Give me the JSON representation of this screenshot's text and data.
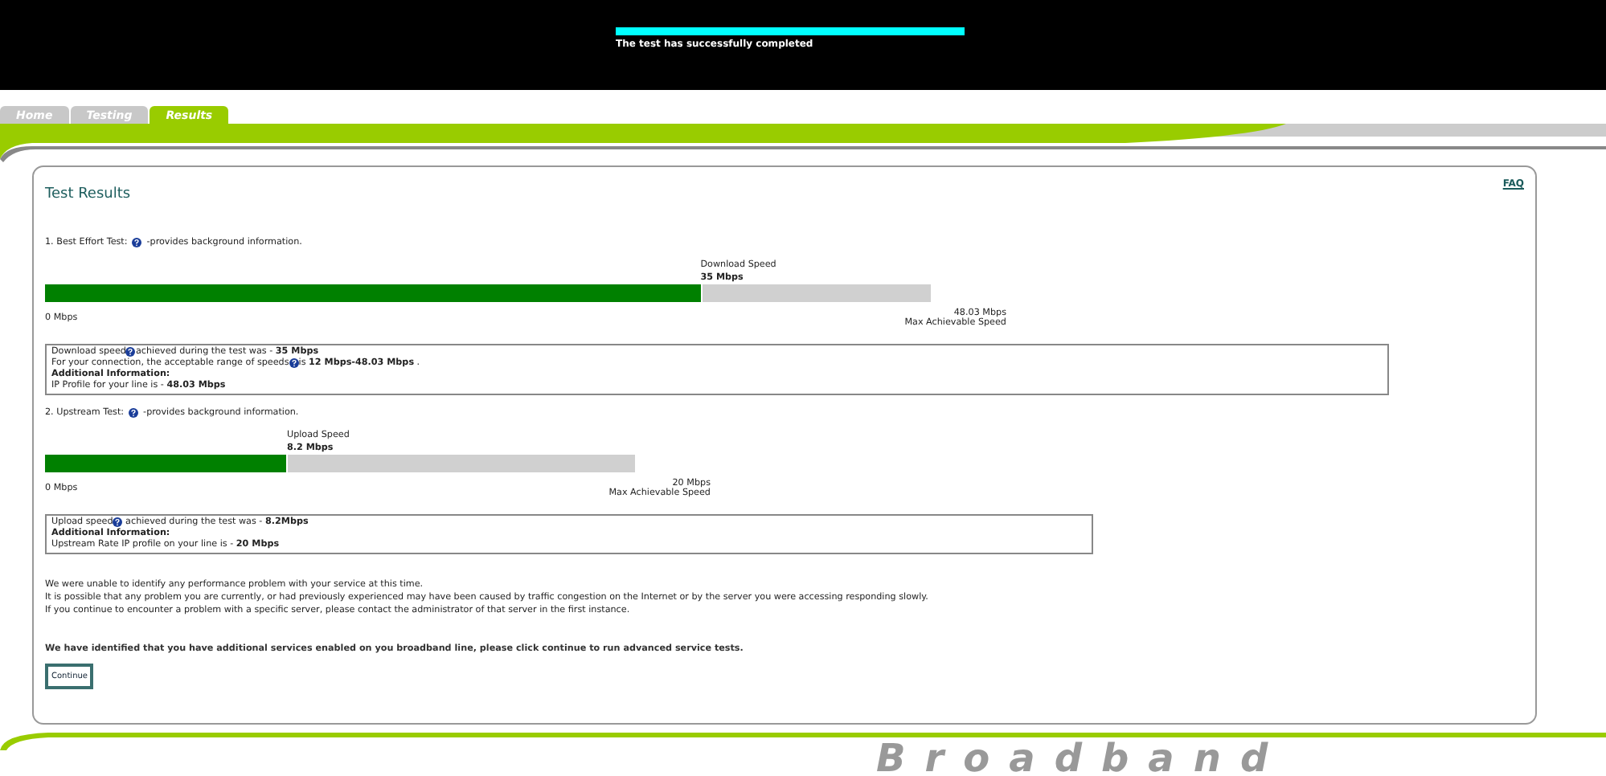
{
  "header": {
    "level": 1,
    "status": "The test has successfully completed"
  },
  "tabs": [
    {
      "label": "Home",
      "selected": false
    },
    {
      "label": "Testing",
      "selected": false
    },
    {
      "label": "Results",
      "selected": true
    }
  ],
  "faq": "FAQ",
  "title": "Test Results",
  "tests": [
    {
      "heading": "1. Best Effort Test:",
      "heading_note": "-provides background information.",
      "speed_label": "Download Speed",
      "speed_value": "35 Mbps",
      "level": 0.74,
      "min_label": "0 Mbps",
      "max_label": "48.03 Mbps",
      "max_caption": "Max Achievable Speed",
      "info": [
        {
          "kind": "line",
          "segments": [
            {
              "kind": "text",
              "text": "Download speed"
            },
            {
              "kind": "help"
            },
            {
              "kind": "text",
              "text": "achieved during the test was - **35 Mbps**"
            }
          ]
        },
        {
          "kind": "line",
          "segments": [
            {
              "kind": "text",
              "text": "For your connection, the acceptable range of speeds"
            },
            {
              "kind": "help"
            },
            {
              "kind": "text",
              "text": "is **12 Mbps-48.03 Mbps** ."
            }
          ]
        },
        {
          "kind": "heading",
          "segments": [
            {
              "kind": "text",
              "text": "Additional Information:"
            }
          ]
        },
        {
          "kind": "line",
          "segments": [
            {
              "kind": "text",
              "text": "IP Profile for your line is - **48.03 Mbps**"
            }
          ]
        }
      ]
    },
    {
      "heading": "2. Upstream Test:",
      "heading_note": "-provides background information.",
      "speed_label": "Upload Speed",
      "speed_value": "8.2 Mbps",
      "level": 0.41,
      "min_label": "0 Mbps",
      "max_label": "20 Mbps",
      "max_caption": "Max Achievable Speed",
      "info": [
        {
          "kind": "line",
          "segments": [
            {
              "kind": "text",
              "text": "Upload speed"
            },
            {
              "kind": "help"
            },
            {
              "kind": "text",
              "text": " achieved during the test was - **8.2Mbps**"
            }
          ]
        },
        {
          "kind": "heading",
          "segments": [
            {
              "kind": "text",
              "text": "Additional Information:"
            }
          ]
        },
        {
          "kind": "line",
          "segments": [
            {
              "kind": "text",
              "text": "Upstream Rate IP profile on your line is - **20 Mbps**"
            }
          ]
        }
      ]
    }
  ],
  "message_lines": [
    "We were unable to identify any performance problem with your service at this time.",
    "It is possible that any problem you are currently, or had previously experienced may have been caused by traffic congestion on the Internet or by the server you were accessing responding slowly.",
    "If you continue to encounter a problem with a specific server, please contact the administrator of that server in the first instance."
  ],
  "notice": "We have identified that you have additional services enabled on you broadband line, please click continue to run advanced service tests.",
  "continue_button": "Continue",
  "footer_brand": "Broadband"
}
